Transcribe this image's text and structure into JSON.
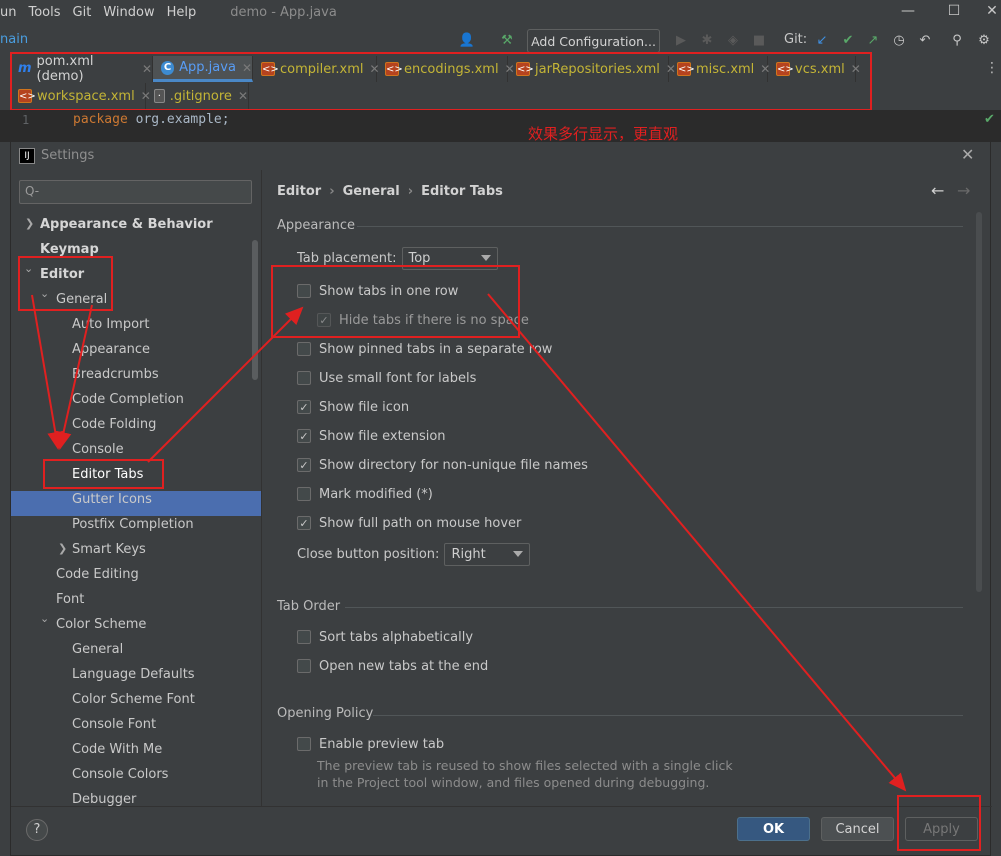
{
  "menu": {
    "items": [
      "un",
      "Tools",
      "Git",
      "Window",
      "Help"
    ],
    "title": "demo - App.java"
  },
  "toolbar": {
    "branch": "nain",
    "add_config": "Add Configuration...",
    "git_label": "Git:"
  },
  "tabs": [
    {
      "label": "pom.xml (demo)",
      "icon": "m-icon",
      "color": "#d4d4d4"
    },
    {
      "label": "App.java",
      "icon": "java-class-icon",
      "color": "#589df6"
    },
    {
      "label": "compiler.xml",
      "icon": "xml-file-icon",
      "color": "#c4b536"
    },
    {
      "label": "encodings.xml",
      "icon": "xml-file-icon",
      "color": "#c4b536"
    },
    {
      "label": "jarRepositories.xml",
      "icon": "xml-file-icon",
      "color": "#c4b536"
    },
    {
      "label": "misc.xml",
      "icon": "xml-file-icon",
      "color": "#c4b536"
    },
    {
      "label": "vcs.xml",
      "icon": "xml-file-icon",
      "color": "#c4b536"
    },
    {
      "label": "workspace.xml",
      "icon": "xml-file-icon",
      "color": "#c4b536"
    },
    {
      "label": ".gitignore",
      "icon": "gitignore-file-icon",
      "color": "#c4b536"
    }
  ],
  "code": {
    "line_no": "1",
    "keyword": "package",
    "rest": " org.example;"
  },
  "annotation": "效果多行显示，更直观",
  "dialog": {
    "title": "Settings",
    "search_placeholder": "Q-",
    "breadcrumb": [
      "Editor",
      "General",
      "Editor Tabs"
    ],
    "tree": [
      "Appearance & Behavior",
      "Keymap",
      "Editor",
      "General",
      "Auto Import",
      "Appearance",
      "Breadcrumbs",
      "Code Completion",
      "Code Folding",
      "Console",
      "Editor Tabs",
      "Gutter Icons",
      "Postfix Completion",
      "Smart Keys",
      "Code Editing",
      "Font",
      "Color Scheme",
      "General",
      "Language Defaults",
      "Color Scheme Font",
      "Console Font",
      "Code With Me",
      "Console Colors",
      "Debugger"
    ],
    "sections": {
      "appearance": "Appearance",
      "tab_order": "Tab Order",
      "opening_policy": "Opening Policy"
    },
    "tab_placement_label": "Tab placement:",
    "tab_placement_value": "Top",
    "options": [
      {
        "label": "Show tabs in one row",
        "checked": false
      },
      {
        "label": "Hide tabs if there is no space",
        "checked": true
      },
      {
        "label": "Show pinned tabs in a separate row",
        "checked": false
      },
      {
        "label": "Use small font for labels",
        "checked": false
      },
      {
        "label": "Show file icon",
        "checked": true
      },
      {
        "label": "Show file extension",
        "checked": true
      },
      {
        "label": "Show directory for non-unique file names",
        "checked": true
      },
      {
        "label": "Mark modified (*)",
        "checked": false
      },
      {
        "label": "Show full path on mouse hover",
        "checked": true
      }
    ],
    "close_button_label": "Close button position:",
    "close_button_value": "Right",
    "order_options": [
      {
        "label": "Sort tabs alphabetically",
        "checked": false
      },
      {
        "label": "Open new tabs at the end",
        "checked": false
      }
    ],
    "preview_option": {
      "label": "Enable preview tab",
      "checked": false
    },
    "preview_help_1": "The preview tab is reused to show files selected with a single click",
    "preview_help_2": "in the Project tool window, and files opened during debugging.",
    "buttons": {
      "help": "?",
      "ok": "OK",
      "cancel": "Cancel",
      "apply": "Apply"
    }
  },
  "colors": {
    "accent": "#4b6eaf",
    "annotation": "#e02020",
    "ok": "#365880"
  }
}
